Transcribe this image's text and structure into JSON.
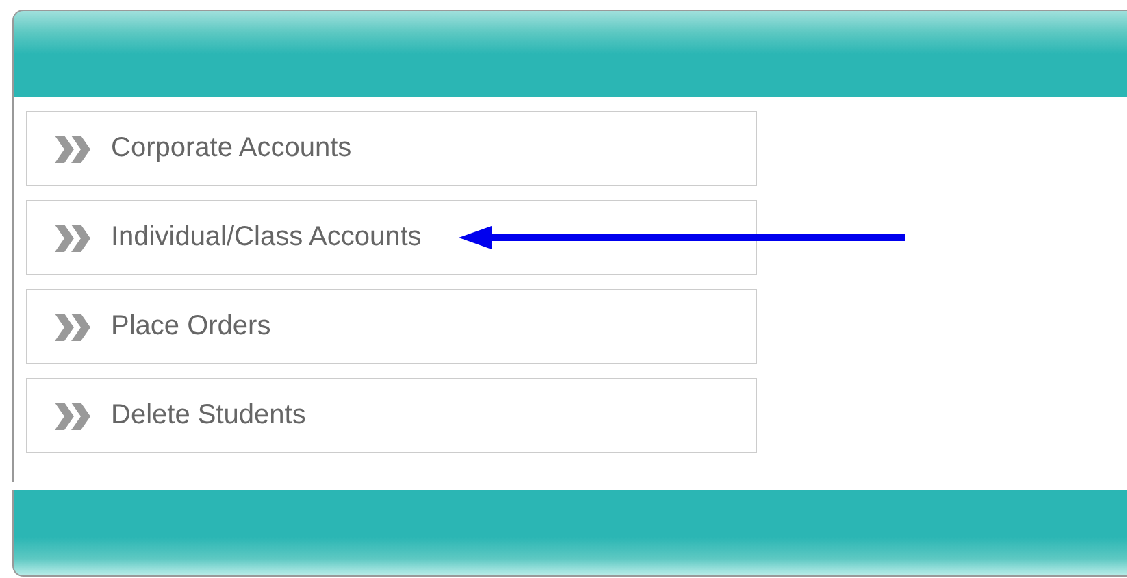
{
  "menu": {
    "items": [
      {
        "label": "Corporate Accounts",
        "pointed_at": false
      },
      {
        "label": "Individual/Class Accounts",
        "pointed_at": true
      },
      {
        "label": "Place Orders",
        "pointed_at": false
      },
      {
        "label": "Delete Students",
        "pointed_at": false
      }
    ]
  }
}
